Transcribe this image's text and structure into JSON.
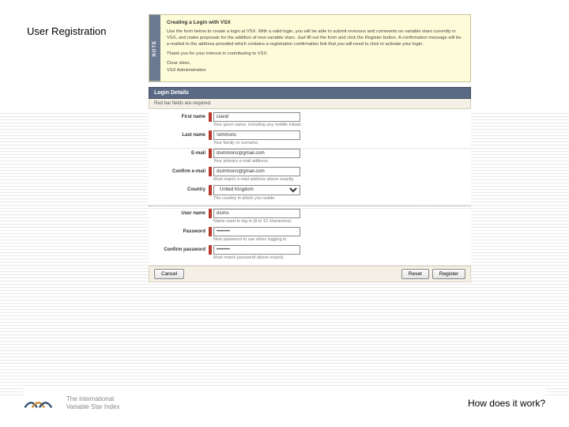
{
  "page_title": "User Registration",
  "note": {
    "tab": "NOTE",
    "title": "Creating a Login with VSX",
    "para1": "Use the form below to create a login at VSX. With a valid login, you will be able to submit revisions and comments on variable stars currently in VSX, and make proposals for the addition of new variable stars. Just fill out the form and click the Register button. A confirmation message will be e-mailed to the address provided which contains a registration confirmation link that you will need to click to activate your login.",
    "para2": "Thank you for your interest in contributing to VSX.",
    "signoff1": "Clear skies,",
    "signoff2": "VSX Administration"
  },
  "section_title": "Login Details",
  "required_note": "Red bar fields are required.",
  "fields": {
    "first_name": {
      "label": "First name",
      "value": "David",
      "hint": "Your given name, including any middle initials."
    },
    "last_name": {
      "label": "Last name",
      "value": "Simmons",
      "hint": "Your family or surname."
    },
    "email": {
      "label": "E-mail",
      "value": "dsimmons@gmail.com",
      "hint": "Your primary e-mail address."
    },
    "confirm_email": {
      "label": "Confirm e-mail",
      "value": "dsimmons@gmail.com",
      "hint": "Must match e-mail address above exactly."
    },
    "country": {
      "label": "Country",
      "value": "United Kingdom",
      "hint": "The country in which you reside."
    },
    "username": {
      "label": "User name",
      "value": "dsims",
      "hint": "Name used to log in (8 to 12 characters)."
    },
    "password": {
      "label": "Password",
      "value": "••••••••",
      "hint": "New password to use when logging in."
    },
    "confirm_password": {
      "label": "Confirm password",
      "value": "••••••••",
      "hint": "Must match password above exactly."
    }
  },
  "buttons": {
    "cancel": "Cancel",
    "reset": "Reset",
    "register": "Register"
  },
  "footer": {
    "logo_line1": "The International",
    "logo_line2": "Variable Star Index",
    "how_link": "How does it work?"
  }
}
